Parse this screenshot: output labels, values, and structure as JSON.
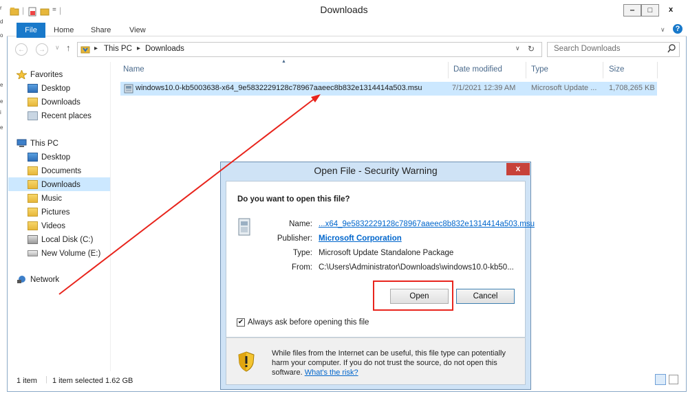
{
  "window": {
    "title": "Downloads",
    "controls": {
      "minimize": "‒",
      "maximize": "□",
      "close": "x"
    }
  },
  "ribbon": {
    "file_tab": "File",
    "tabs": [
      "Home",
      "Share",
      "View"
    ]
  },
  "address": {
    "path": [
      "This PC",
      "Downloads"
    ],
    "separator": "▸",
    "search_placeholder": "Search Downloads"
  },
  "nav_pane": {
    "favorites": {
      "label": "Favorites",
      "items": [
        "Desktop",
        "Downloads",
        "Recent places"
      ]
    },
    "this_pc": {
      "label": "This PC",
      "items": [
        "Desktop",
        "Documents",
        "Downloads",
        "Music",
        "Pictures",
        "Videos",
        "Local Disk (C:)",
        "New Volume (E:)"
      ]
    },
    "network": {
      "label": "Network"
    },
    "selected": "Downloads"
  },
  "file_list": {
    "columns": [
      "Name",
      "Date modified",
      "Type",
      "Size"
    ],
    "rows": [
      {
        "name": "windows10.0-kb5003638-x64_9e5832229128c78967aaeec8b832e1314414a503.msu",
        "date_modified": "7/1/2021 12:39 AM",
        "type": "Microsoft Update ...",
        "size": "1,708,265 KB"
      }
    ]
  },
  "status_bar": {
    "item_count": "1 item",
    "selection": "1 item selected 1.62 GB"
  },
  "dialog": {
    "title": "Open File - Security Warning",
    "close": "x",
    "question": "Do you want to open this file?",
    "labels": {
      "name": "Name:",
      "publisher": "Publisher:",
      "type": "Type:",
      "from": "From:"
    },
    "values": {
      "name": "...x64_9e5832229128c78967aaeec8b832e1314414a503.msu",
      "publisher": "Microsoft Corporation",
      "type": "Microsoft Update Standalone Package",
      "from": "C:\\Users\\Administrator\\Downloads\\windows10.0-kb50..."
    },
    "open_button": "Open",
    "cancel_button": "Cancel",
    "always_ask": "Always ask before opening this file",
    "always_ask_checked": true,
    "warning_text": "While files from the Internet can be useful, this file type can potentially harm your computer. If you do not trust the source, do not open this software.",
    "risk_link": "What's the risk?"
  },
  "left_strip": [
    "r",
    "d",
    "o",
    "e",
    "e",
    "i",
    "e"
  ],
  "colors": {
    "accent": "#1979ca",
    "annotation": "#e8241c",
    "selection": "#cce8ff"
  }
}
